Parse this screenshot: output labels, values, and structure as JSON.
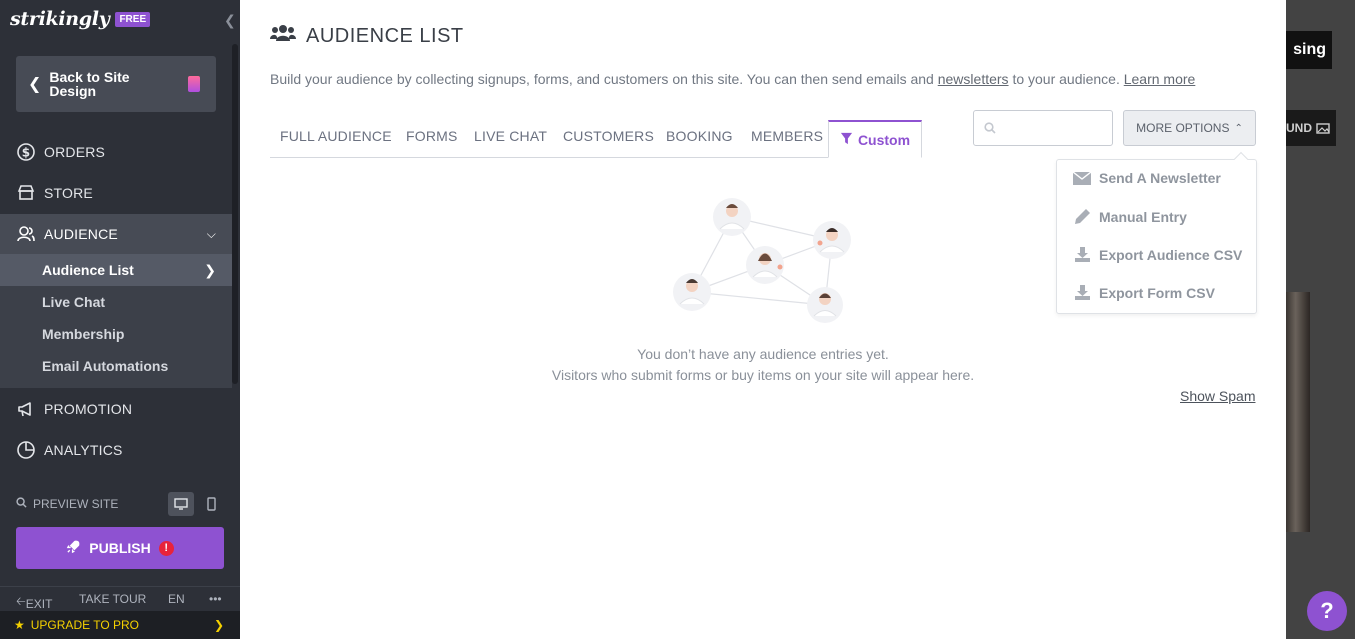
{
  "brand": {
    "logo": "strikingly",
    "badge": "FREE"
  },
  "sidebar": {
    "back_label": "Back to Site Design",
    "nav": [
      {
        "label": "ORDERS",
        "icon": "dollar-circle-icon"
      },
      {
        "label": "STORE",
        "icon": "store-icon"
      },
      {
        "label": "AUDIENCE",
        "icon": "audience-icon"
      },
      {
        "label": "PROMOTION",
        "icon": "megaphone-icon"
      },
      {
        "label": "ANALYTICS",
        "icon": "pie-chart-icon"
      }
    ],
    "audience_sub": [
      {
        "label": "Audience List"
      },
      {
        "label": "Live Chat"
      },
      {
        "label": "Membership"
      },
      {
        "label": "Email Automations"
      }
    ],
    "preview_label": "PREVIEW SITE",
    "publish_label": "PUBLISH",
    "publish_alert": "!",
    "footer": {
      "exit": "EXIT",
      "tour": "TAKE TOUR",
      "lang": "EN",
      "more": "•••"
    },
    "upgrade_label": "UPGRADE TO PRO"
  },
  "main": {
    "title": "AUDIENCE LIST",
    "intro_text": "Build your audience by collecting signups, forms, and customers on this site. You can then send emails and",
    "intro_link1": "newsletters",
    "intro_mid": "to your audience.",
    "intro_link2": "Learn more",
    "tabs": [
      "FULL AUDIENCE",
      "FORMS",
      "LIVE CHAT",
      "CUSTOMERS",
      "BOOKING",
      "MEMBERS"
    ],
    "custom_tab": "Custom",
    "search_value": "",
    "more_options": "MORE OPTIONS",
    "dropdown": [
      {
        "label": "Send A Newsletter",
        "icon": "envelope-icon"
      },
      {
        "label": "Manual Entry",
        "icon": "pencil-icon"
      },
      {
        "label": "Export Audience CSV",
        "icon": "download-icon"
      },
      {
        "label": "Export Form CSV",
        "icon": "download-icon"
      }
    ],
    "empty_line1": "You don’t have any audience entries yet.",
    "empty_line2": "Visitors who submit forms or buy items on your site will appear here.",
    "show_spam": "Show Spam"
  },
  "preview": {
    "btn1": "sing",
    "btn2": "UND"
  },
  "colors": {
    "accent": "#8e52d1",
    "sidebar_bg": "#2d3038",
    "alert": "#e8233a",
    "upgrade": "#f5d100"
  }
}
